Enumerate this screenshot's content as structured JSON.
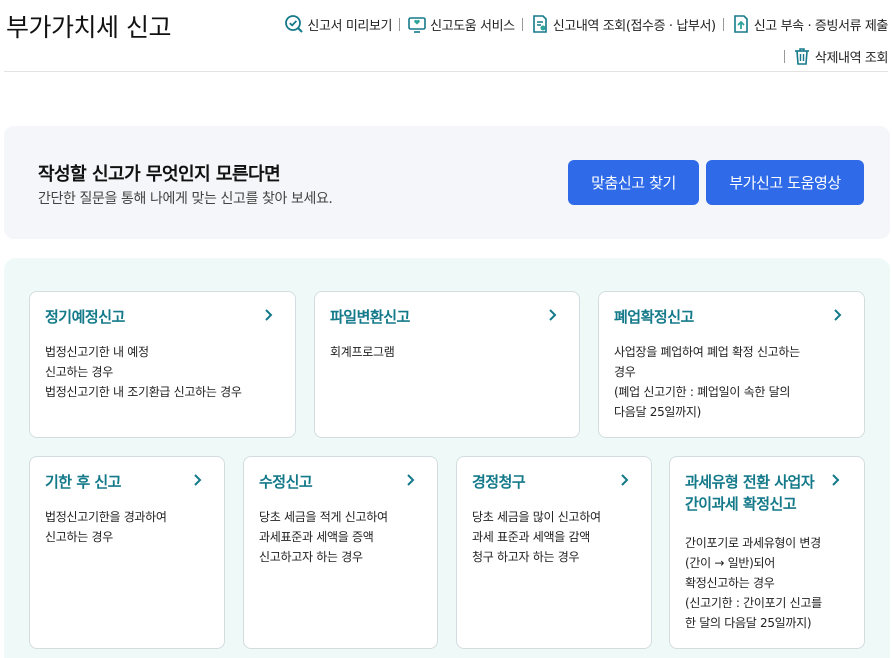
{
  "page": {
    "title": "부가가치세 신고"
  },
  "top_links": [
    {
      "label": "신고서 미리보기",
      "icon": "magnifier-check-icon"
    },
    {
      "label": "신고도움 서비스",
      "icon": "monitor-help-icon"
    },
    {
      "label": "신고내역 조회(접수증 · 납부서)",
      "icon": "document-search-icon"
    },
    {
      "label": "신고 부속 · 증빙서류 제출",
      "icon": "document-upload-icon"
    },
    {
      "label": "삭제내역 조회",
      "icon": "trash-icon"
    }
  ],
  "banner": {
    "title": "작성할 신고가 무엇인지 모른다면",
    "subtitle": "간단한 질문을 통해 나에게 맞는 신고를 찾아 보세요.",
    "find_button": "맞춤신고 찾기",
    "video_button": "부가신고 도움영상"
  },
  "cards": [
    {
      "title": [
        "정기예정신고"
      ],
      "desc": [
        "법정신고기한 내 예정",
        "신고하는 경우",
        "법정신고기한 내 조기환급 신고하는 경우"
      ]
    },
    {
      "title": [
        "파일변환신고"
      ],
      "desc": [
        "회계프로그램"
      ]
    },
    {
      "title": [
        "폐업확정신고"
      ],
      "desc": [
        "사업장을 폐업하여 폐업 확정 신고하는",
        "경우",
        "(폐업 신고기한 : 폐업일이 속한 달의",
        "다음달 25일까지)"
      ]
    },
    {
      "title": [
        "기한 후 신고"
      ],
      "desc": [
        "법정신고기한을 경과하여",
        "신고하는 경우"
      ]
    },
    {
      "title": [
        "수정신고"
      ],
      "desc": [
        "당초 세금을 적게 신고하여",
        "과세표준과 세액을 증액",
        "신고하고자 하는 경우"
      ]
    },
    {
      "title": [
        "경정청구"
      ],
      "desc": [
        "당초 세금을 많이 신고하여",
        "과세 표준과 세액을 감액",
        "청구 하고자 하는 경우"
      ]
    },
    {
      "title": [
        "과세유형 전환 사업자",
        "간이과세 확정신고"
      ],
      "desc": [
        "간이포기로 과세유형이 변경",
        "(간이 → 일반)되어",
        "확정신고하는 경우",
        "(신고기한 : 간이포기 신고를",
        "한 달의 다음달 25일까지)"
      ]
    }
  ],
  "colors": {
    "accent": "#2f6be8",
    "card_title": "#147a8a",
    "cards_bg": "#effaf8",
    "banner_bg": "#f4f6fa"
  }
}
